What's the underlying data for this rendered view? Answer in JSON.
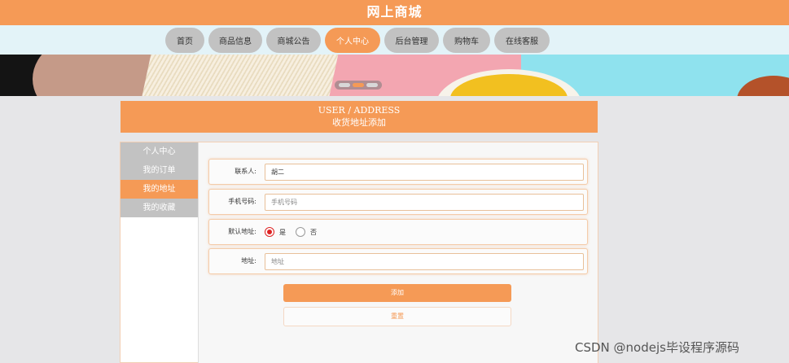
{
  "site": {
    "title": "网上商城"
  },
  "nav": {
    "items": [
      {
        "label": "首页",
        "active": false
      },
      {
        "label": "商品信息",
        "active": false
      },
      {
        "label": "商城公告",
        "active": false
      },
      {
        "label": "个人中心",
        "active": true
      },
      {
        "label": "后台管理",
        "active": false
      },
      {
        "label": "购物车",
        "active": false
      },
      {
        "label": "在线客服",
        "active": false
      }
    ]
  },
  "page": {
    "title_en": "USER / ADDRESS",
    "title_cn": "收货地址添加"
  },
  "sidebar": {
    "items": [
      {
        "label": "个人中心",
        "active": false
      },
      {
        "label": "我的订单",
        "active": false
      },
      {
        "label": "我的地址",
        "active": true
      },
      {
        "label": "我的收藏",
        "active": false
      }
    ]
  },
  "form": {
    "contact": {
      "label": "联系人:",
      "value": "胡二"
    },
    "phone": {
      "label": "手机号码:",
      "placeholder": "手机号码",
      "value": ""
    },
    "default": {
      "label": "默认地址:",
      "options": [
        "是",
        "否"
      ],
      "selected": "是"
    },
    "address": {
      "label": "地址:",
      "placeholder": "地址",
      "value": ""
    },
    "submit_label": "添加",
    "reset_label": "重置"
  },
  "watermark": "CSDN @nodejs毕设程序源码",
  "colors": {
    "accent": "#f59a56",
    "nav_inactive": "#c2c2c2",
    "nav_bar": "#e3f3f8",
    "background": "#e6e6e8"
  }
}
